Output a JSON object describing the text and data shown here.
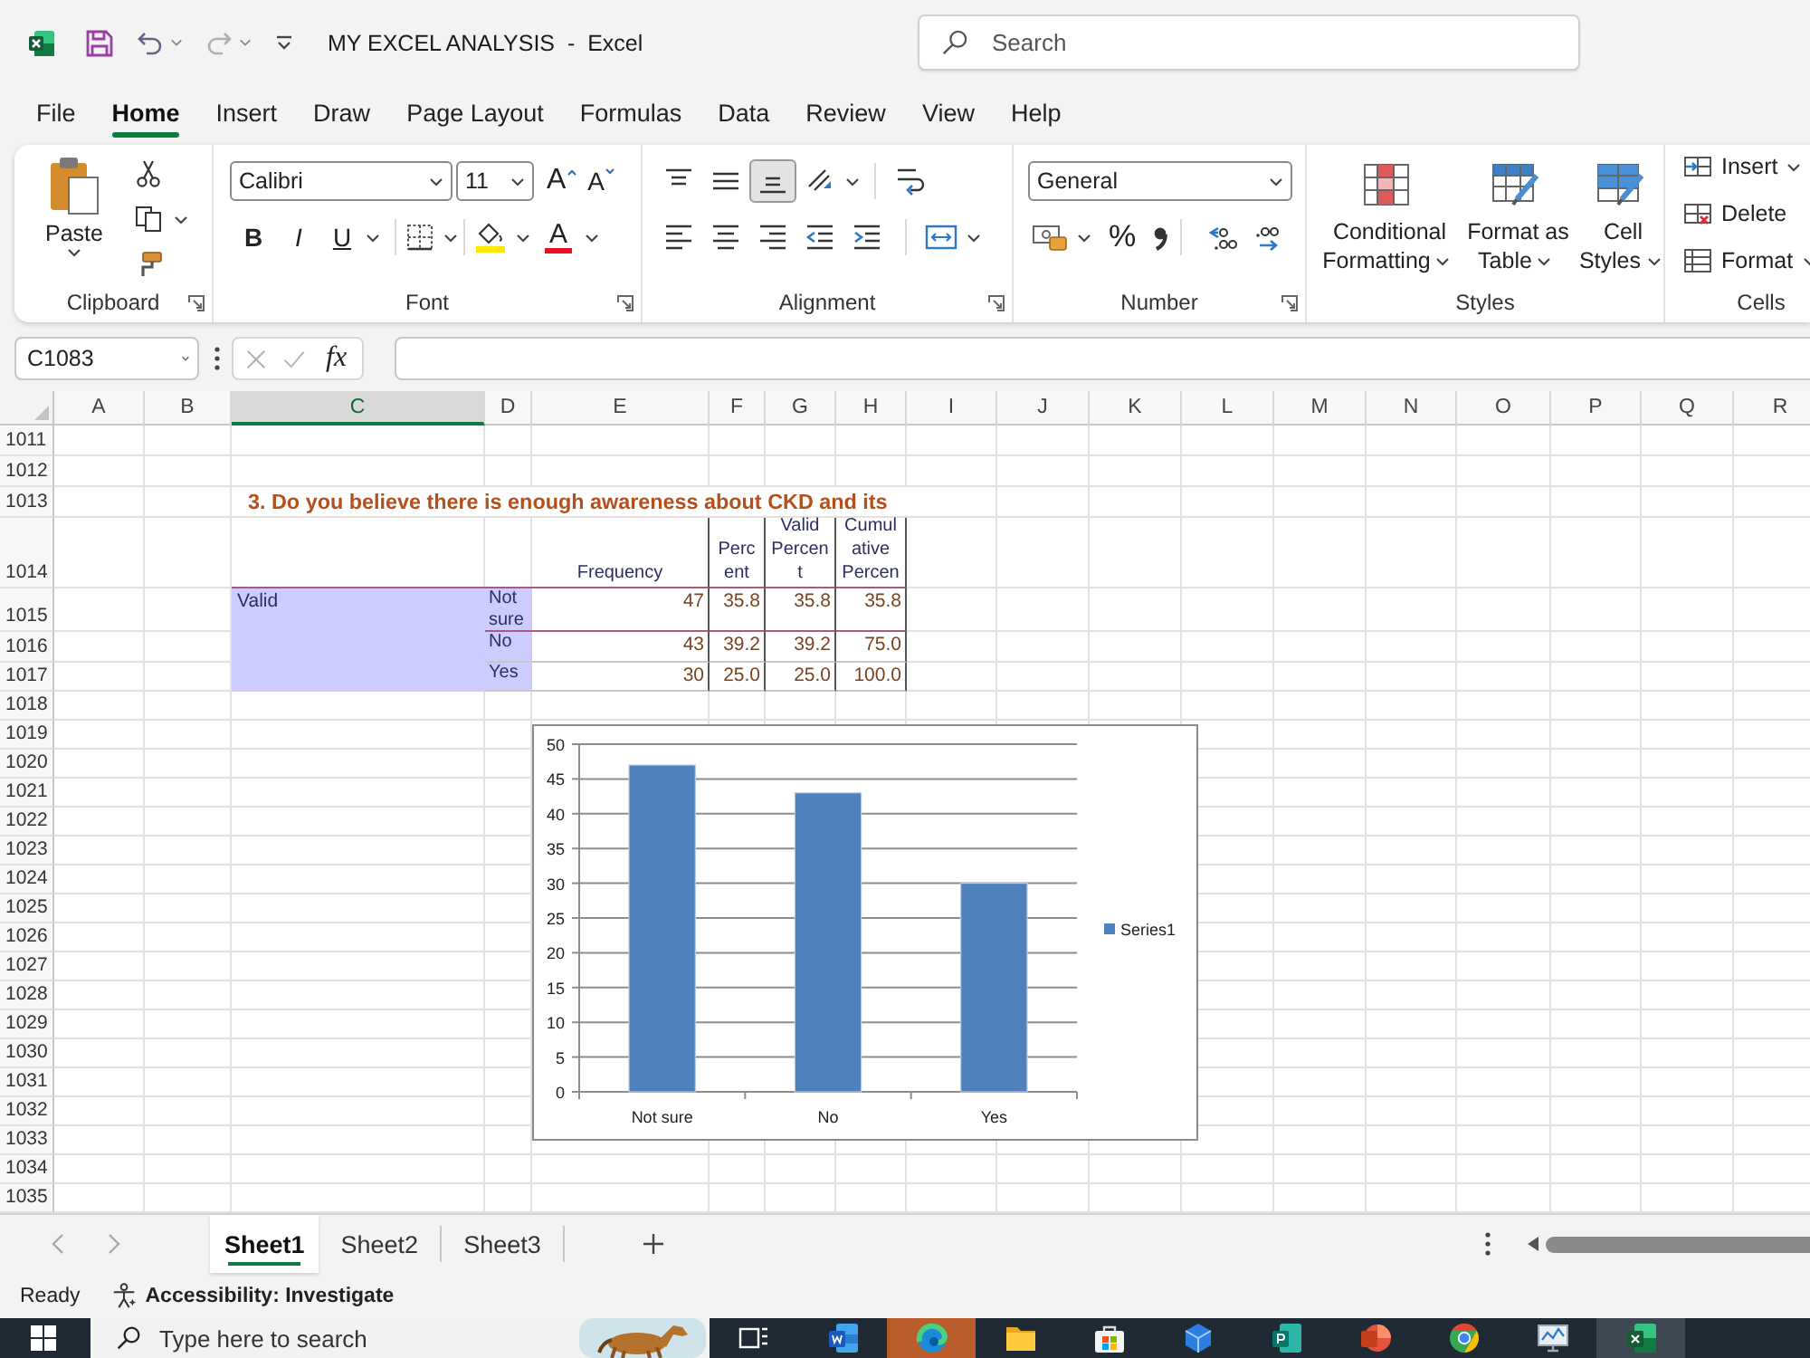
{
  "title_bar": {
    "quick_access": [
      {
        "kind": "save",
        "disabled": false
      },
      {
        "kind": "undo",
        "disabled": false
      },
      {
        "kind": "redo",
        "disabled": true
      },
      {
        "kind": "customize",
        "disabled": false
      }
    ],
    "title": "MY EXCEL ANALYSIS  -  Excel",
    "search": {
      "placeholder": "Search"
    }
  },
  "menu": [
    {
      "label": "File",
      "selected": false
    },
    {
      "label": "Home",
      "selected": true
    },
    {
      "label": "Insert",
      "selected": false
    },
    {
      "label": "Draw",
      "selected": false
    },
    {
      "label": "Page Layout",
      "selected": false
    },
    {
      "label": "Formulas",
      "selected": false
    },
    {
      "label": "Data",
      "selected": false
    },
    {
      "label": "Review",
      "selected": false
    },
    {
      "label": "View",
      "selected": false
    },
    {
      "label": "Help",
      "selected": false
    }
  ],
  "ribbon": {
    "groups": [
      {
        "kind": "clipboard",
        "label": "Clipboard",
        "launcher": true,
        "paste": "Paste"
      },
      {
        "kind": "font",
        "label": "Font",
        "launcher": true,
        "font_name": "Calibri",
        "font_size": "11",
        "grow": "A",
        "shrink": "A",
        "bold": "B",
        "italic": "I",
        "underline": "U",
        "font_color": "A"
      },
      {
        "kind": "alignment",
        "label": "Alignment",
        "launcher": true,
        "vertical": [
          {
            "kind": "top",
            "selected": false
          },
          {
            "kind": "middle",
            "selected": false
          },
          {
            "kind": "bottom",
            "selected": true
          }
        ]
      },
      {
        "kind": "number",
        "label": "Number",
        "launcher": true,
        "format": "General",
        "percent": "%"
      },
      {
        "kind": "styles",
        "label": "Styles",
        "launcher": false,
        "buttons": [
          {
            "kind": "conditional",
            "label": "Conditional\nFormatting",
            "dropdown": true
          },
          {
            "kind": "table",
            "label": "Format as\nTable",
            "dropdown": true
          },
          {
            "kind": "cell",
            "label": "Cell\nStyles",
            "dropdown": true
          }
        ]
      },
      {
        "kind": "cells",
        "label": "Cells",
        "launcher": false,
        "buttons": [
          {
            "kind": "insert",
            "label": "Insert",
            "dropdown": true
          },
          {
            "kind": "delete",
            "label": "Delete",
            "dropdown": false
          },
          {
            "kind": "format",
            "label": "Format",
            "dropdown": true
          }
        ]
      }
    ]
  },
  "formula_bar": {
    "name_box": "C1083",
    "cancel_disabled": true,
    "enter_disabled": true,
    "function": "fx"
  },
  "sheet": {
    "columns": [
      {
        "label": "A",
        "selected": false
      },
      {
        "label": "B",
        "selected": false
      },
      {
        "label": "C",
        "selected": true
      },
      {
        "label": "D",
        "selected": false
      },
      {
        "label": "E",
        "selected": false
      },
      {
        "label": "F",
        "selected": false
      },
      {
        "label": "G",
        "selected": false
      },
      {
        "label": "H",
        "selected": false
      },
      {
        "label": "I",
        "selected": false
      },
      {
        "label": "J",
        "selected": false
      },
      {
        "label": "K",
        "selected": false
      },
      {
        "label": "L",
        "selected": false
      },
      {
        "label": "M",
        "selected": false
      },
      {
        "label": "N",
        "selected": false
      },
      {
        "label": "O",
        "selected": false
      },
      {
        "label": "P",
        "selected": false
      },
      {
        "label": "Q",
        "selected": false
      },
      {
        "label": "R",
        "selected": false
      }
    ],
    "rows": [
      "1011",
      "1012",
      "1013",
      "1014",
      "1015",
      "1016",
      "1017",
      "1018",
      "1019",
      "1020",
      "1021",
      "1022",
      "1023",
      "1024",
      "1025",
      "1026",
      "1027",
      "1028",
      "1029",
      "1030",
      "1031",
      "1032",
      "1033",
      "1034",
      "1035"
    ],
    "title": "3. Do you believe there is enough awareness about CKD and its",
    "table": {
      "header": [
        "Frequency",
        "Perc\nent",
        "Valid\nPercen\nt",
        "Cumul\native\nPercen"
      ],
      "group": "Valid",
      "rows": [
        {
          "label": "Not\nsure",
          "cells": [
            "47",
            "35.8",
            "35.8",
            "35.8"
          ]
        },
        {
          "label": "No",
          "cells": [
            "43",
            "39.2",
            "39.2",
            "75.0"
          ]
        },
        {
          "label": "Yes",
          "cells": [
            "30",
            "25.0",
            "25.0",
            "100.0"
          ]
        }
      ]
    },
    "chart_data": {
      "type": "bar",
      "categories": [
        "Not sure",
        "No",
        "Yes"
      ],
      "series": [
        {
          "name": "Series1",
          "color": "#4f81bd",
          "values": [
            47,
            43,
            30
          ]
        }
      ],
      "ylim": [
        0,
        50
      ],
      "yticks": [
        0,
        5,
        10,
        15,
        20,
        25,
        30,
        35,
        40,
        45,
        50
      ],
      "grid": true,
      "legend": "right"
    }
  },
  "sheet_tabs": {
    "nav": [
      {
        "kind": "prev",
        "disabled": true
      },
      {
        "kind": "next",
        "disabled": true
      }
    ],
    "tabs": [
      {
        "label": "Sheet1",
        "selected": true
      },
      {
        "label": "Sheet2",
        "selected": false
      },
      {
        "label": "Sheet3",
        "selected": false
      }
    ]
  },
  "status_bar": {
    "status": "Ready",
    "accessibility": "Accessibility: Investigate"
  },
  "taskbar": {
    "search": {
      "placeholder": "Type here to search"
    },
    "apps": [
      {
        "kind": "task_view",
        "active": false,
        "flashing": false
      },
      {
        "kind": "word",
        "active": false,
        "flashing": false
      },
      {
        "kind": "edge",
        "active": false,
        "flashing": true
      },
      {
        "kind": "folder",
        "active": false,
        "flashing": false
      },
      {
        "kind": "store",
        "active": false,
        "flashing": false
      },
      {
        "kind": "cube",
        "active": false,
        "flashing": false
      },
      {
        "kind": "publisher",
        "active": false,
        "flashing": false
      },
      {
        "kind": "red_app",
        "active": false,
        "flashing": false
      },
      {
        "kind": "chrome",
        "active": false,
        "flashing": false
      },
      {
        "kind": "monitor",
        "active": false,
        "flashing": false
      },
      {
        "kind": "excel",
        "active": true,
        "flashing": false
      }
    ]
  }
}
